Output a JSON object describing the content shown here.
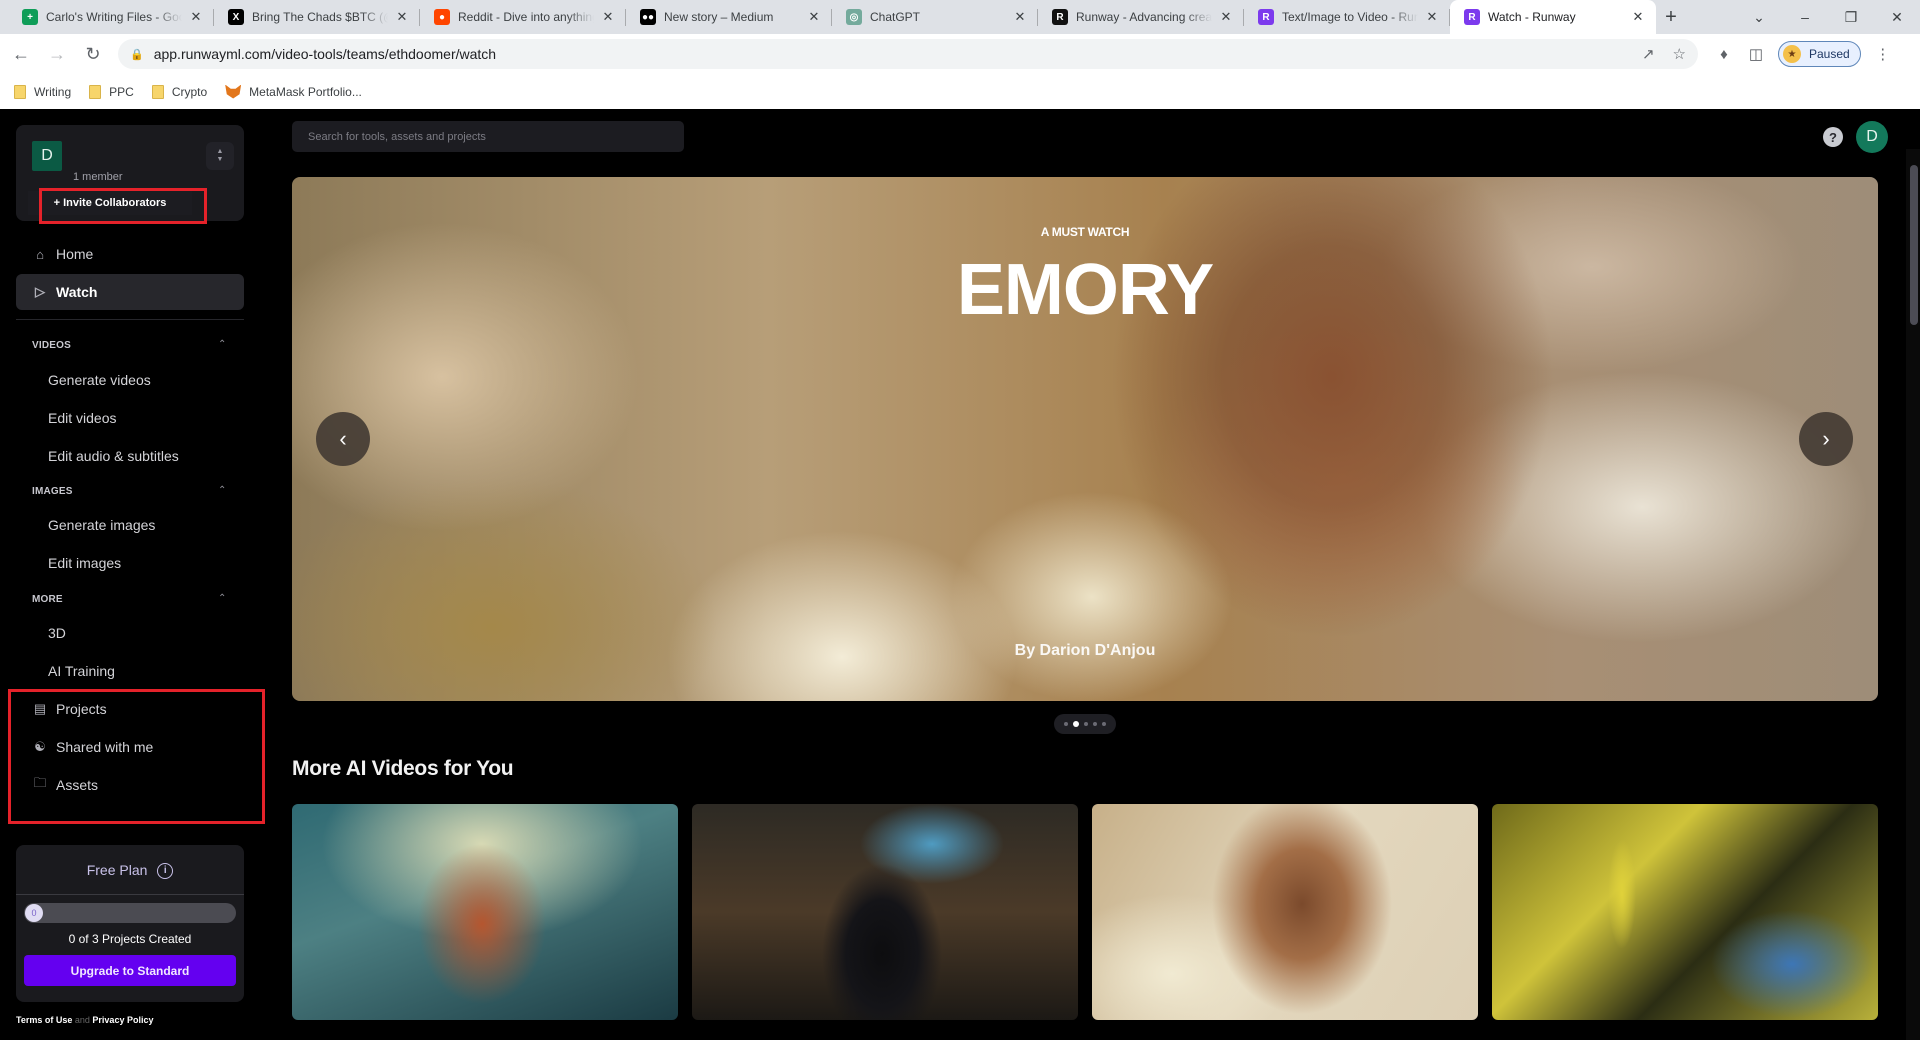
{
  "browser": {
    "tabs": [
      {
        "title": "Carlo's Writing Files - Google Drive",
        "favicon": "sheets-icon",
        "color": "#0f9d58",
        "glyph": "+"
      },
      {
        "title": "Bring The Chads $BTC (@BTC)",
        "favicon": "x-icon",
        "color": "#000000",
        "glyph": "X"
      },
      {
        "title": "Reddit - Dive into anything",
        "favicon": "reddit-icon",
        "color": "#ff4500",
        "glyph": "●"
      },
      {
        "title": "New story – Medium",
        "favicon": "medium-icon",
        "color": "#000000",
        "glyph": "●●"
      },
      {
        "title": "ChatGPT",
        "favicon": "chatgpt-icon",
        "color": "#74aa9c",
        "glyph": "◎"
      },
      {
        "title": "Runway - Advancing creativity",
        "favicon": "runway-icon",
        "color": "#111111",
        "glyph": "R"
      },
      {
        "title": "Text/Image to Video - Runway",
        "favicon": "runway-icon",
        "color": "#7c3aed",
        "glyph": "R"
      },
      {
        "title": "Watch - Runway",
        "favicon": "runway-icon",
        "color": "#7c3aed",
        "glyph": "R",
        "active": true
      }
    ],
    "url": "app.runwayml.com/video-tools/teams/ethdoomer/watch",
    "profile_status": "Paused",
    "bookmarks": [
      {
        "label": "Writing",
        "icon": "folder-icon"
      },
      {
        "label": "PPC",
        "icon": "folder-icon"
      },
      {
        "label": "Crypto",
        "icon": "folder-icon"
      },
      {
        "label": "MetaMask Portfolio...",
        "icon": "metamask-icon"
      }
    ]
  },
  "sidebar": {
    "team": {
      "avatar_letter": "D",
      "members": "1 member"
    },
    "invite_label": "+ Invite Collaborators",
    "nav": [
      {
        "label": "Home",
        "icon": "home-icon"
      },
      {
        "label": "Watch",
        "icon": "play-icon",
        "active": true
      }
    ],
    "sections": [
      {
        "label": "VIDEOS",
        "items": [
          "Generate videos",
          "Edit videos",
          "Edit audio & subtitles"
        ]
      },
      {
        "label": "IMAGES",
        "items": [
          "Generate images",
          "Edit images"
        ]
      },
      {
        "label": "MORE",
        "items": [
          "3D",
          "AI Training"
        ]
      }
    ],
    "library": [
      {
        "label": "Projects",
        "icon": "projects-icon"
      },
      {
        "label": "Shared with me",
        "icon": "shared-icon"
      },
      {
        "label": "Assets",
        "icon": "folder-icon"
      }
    ],
    "plan": {
      "title": "Free Plan",
      "progress_value": 0,
      "progress_max": 3,
      "progress_label": "0",
      "count_text": "0 of 3 Projects Created",
      "upgrade_label": "Upgrade to Standard",
      "accent": "#6400f0"
    },
    "legal": {
      "terms": "Terms of Use",
      "and": "and",
      "privacy": "Privacy Policy"
    }
  },
  "main": {
    "search_placeholder": "Search for tools, assets and projects",
    "user_avatar": "D",
    "hero": {
      "eyebrow": "A MUST WATCH",
      "title": "EMORY",
      "byline": "By Darion D'Anjou",
      "slide_count": 5,
      "active_slide": 1
    },
    "section_title": "More AI Videos for You",
    "videos": [
      {
        "description": "Woman with curly hair in red coat in tunnel"
      },
      {
        "description": "Silhouette walking down city street at night"
      },
      {
        "description": "Smiling woman with flowers"
      },
      {
        "description": "Figure in yellow standing in yellow landscape"
      }
    ]
  }
}
